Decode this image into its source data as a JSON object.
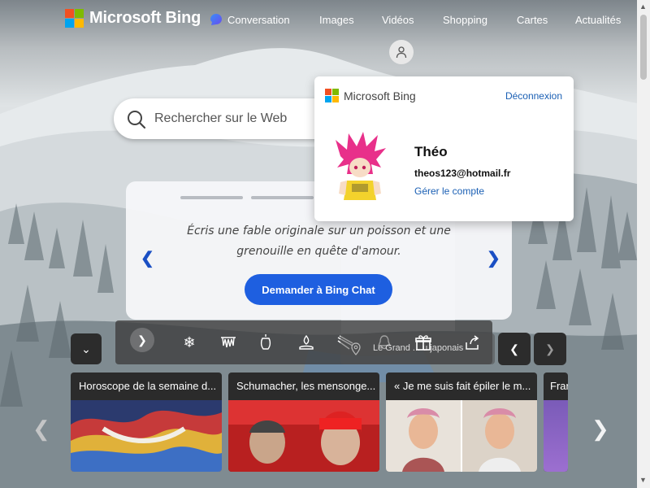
{
  "nav": {
    "brand": "Microsoft Bing",
    "items": [
      "Conversation",
      "Images",
      "Vidéos",
      "Shopping",
      "Cartes",
      "Actualités"
    ]
  },
  "search": {
    "placeholder": "Rechercher sur le Web"
  },
  "profile": {
    "brand": "Microsoft Bing",
    "logout": "Déconnexion",
    "name": "Théo",
    "email": "theos123@hotmail.fr",
    "manage": "Gérer le compte"
  },
  "chat_card": {
    "prompt": "Écris une fable originale sur un poisson et une grenouille en quête d'amour.",
    "button": "Demander à Bing Chat"
  },
  "location": {
    "label": "Le Grand ... u japonais"
  },
  "news": [
    {
      "title": "Horoscope de la semaine d..."
    },
    {
      "title": "Schumacher, les mensonge..."
    },
    {
      "title": "« Je me suis fait épiler le m..."
    },
    {
      "title": "Fran"
    }
  ],
  "colors": {
    "bing_blue": "#1e5fe0",
    "link": "#1a5fb4"
  },
  "icons": [
    "snowflake-icon",
    "ice-cave-icon",
    "lantern-icon",
    "campfire-icon",
    "skis-icon",
    "bell-icon",
    "gift-icon",
    "share-icon",
    "location-pin-icon"
  ]
}
